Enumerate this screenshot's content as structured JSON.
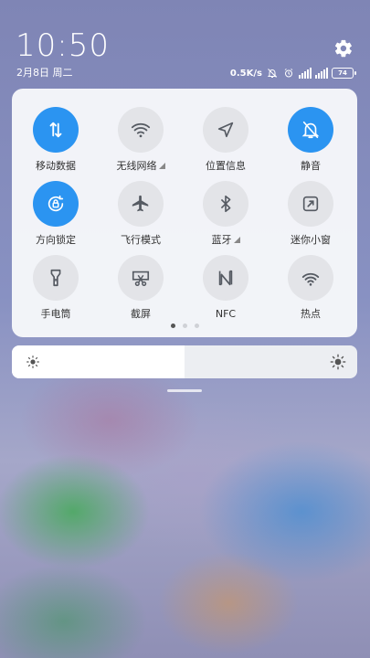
{
  "status": {
    "time": "10:50",
    "date": "2月8日 周二",
    "net_speed": "0.5K/s",
    "battery": "74"
  },
  "toggles": [
    {
      "id": "mobile-data",
      "label": "移动数据",
      "icon": "data-arrows-icon",
      "on": true
    },
    {
      "id": "wifi",
      "label": "无线网络",
      "icon": "wifi-icon",
      "on": false,
      "sub": true
    },
    {
      "id": "location",
      "label": "位置信息",
      "icon": "location-icon",
      "on": false
    },
    {
      "id": "silent",
      "label": "静音",
      "icon": "bell-off-icon",
      "on": true
    },
    {
      "id": "rotation-lock",
      "label": "方向锁定",
      "icon": "rotation-lock-icon",
      "on": true
    },
    {
      "id": "airplane",
      "label": "飞行模式",
      "icon": "airplane-icon",
      "on": false
    },
    {
      "id": "bluetooth",
      "label": "蓝牙",
      "icon": "bluetooth-icon",
      "on": false,
      "sub": true
    },
    {
      "id": "mini-window",
      "label": "迷你小窗",
      "icon": "mini-window-icon",
      "on": false
    },
    {
      "id": "flashlight",
      "label": "手电筒",
      "icon": "flashlight-icon",
      "on": false
    },
    {
      "id": "screenshot",
      "label": "截屏",
      "icon": "scissors-icon",
      "on": false
    },
    {
      "id": "nfc",
      "label": "NFC",
      "icon": "nfc-icon",
      "on": false
    },
    {
      "id": "hotspot",
      "label": "热点",
      "icon": "hotspot-icon",
      "on": false
    }
  ],
  "pages": {
    "count": 3,
    "active": 0
  },
  "brightness": {
    "level": 0.5
  },
  "colors": {
    "accent": "#2b94f1",
    "tile_off": "#e3e4e8",
    "panel": "#f6f7fa"
  }
}
